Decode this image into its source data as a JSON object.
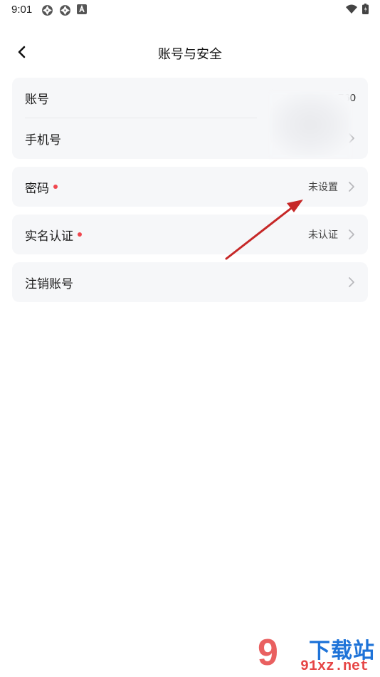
{
  "status_bar": {
    "time": "9:01"
  },
  "header": {
    "title": "账号与安全"
  },
  "card1": {
    "account": {
      "label": "账号",
      "value": "760"
    },
    "phone": {
      "label": "手机号"
    }
  },
  "password": {
    "label": "密码",
    "value": "未设置"
  },
  "realname": {
    "label": "实名认证",
    "value": "未认证"
  },
  "cancel": {
    "label": "注销账号"
  },
  "watermark": {
    "mark": "9",
    "brand": "下载站",
    "url": "91xz.net"
  },
  "colors": {
    "background": "#ffffff",
    "card": "#f6f7f9",
    "red_dot": "#f0474f",
    "arrow": "#d32f2f"
  }
}
